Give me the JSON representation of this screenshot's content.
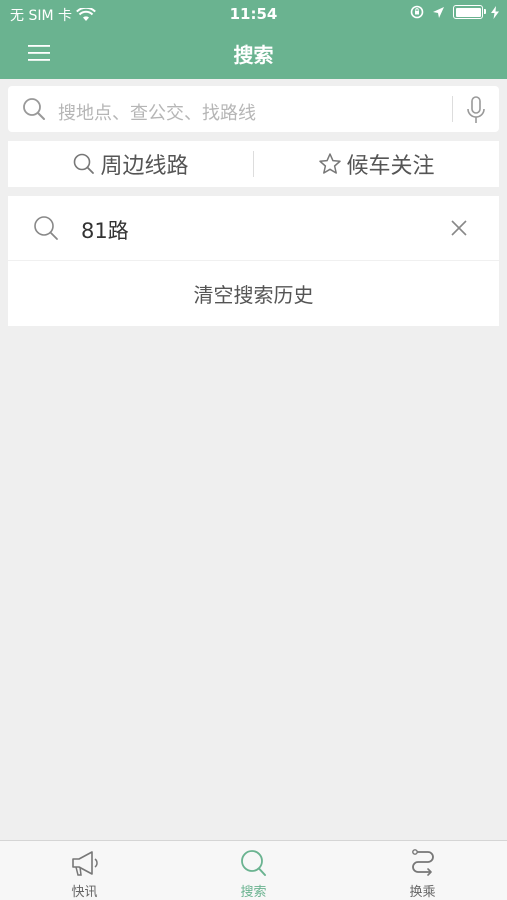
{
  "statusbar": {
    "carrier": "无 SIM 卡",
    "time": "11:54"
  },
  "nav": {
    "title": "搜索",
    "menu_icon": "menu-icon"
  },
  "search": {
    "placeholder": "搜地点、查公交、找路线",
    "search_icon": "search-icon",
    "mic_icon": "microphone-icon"
  },
  "tabs": [
    {
      "label": "周边线路",
      "icon": "search-icon"
    },
    {
      "label": "候车关注",
      "icon": "star-icon"
    }
  ],
  "history": {
    "items": [
      {
        "text": "81路"
      }
    ],
    "clear_label": "清空搜索历史"
  },
  "tabbar": [
    {
      "label": "快讯",
      "icon": "megaphone-icon",
      "active": false
    },
    {
      "label": "搜索",
      "icon": "search-icon",
      "active": true
    },
    {
      "label": "换乘",
      "icon": "route-icon",
      "active": false
    }
  ],
  "colors": {
    "accent": "#6ab390",
    "background": "#efefef"
  }
}
